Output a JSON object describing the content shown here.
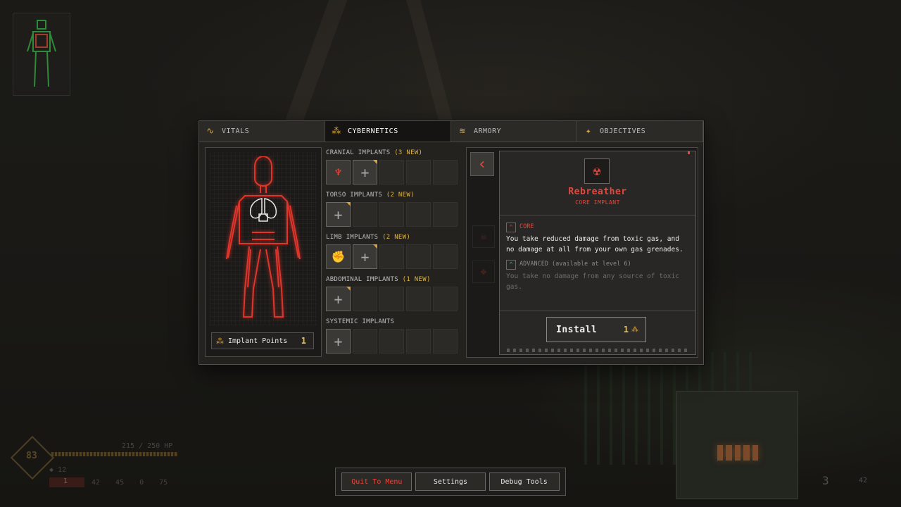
{
  "tabs": [
    {
      "label": "VITALS",
      "icon": "vitals-icon",
      "active": false
    },
    {
      "label": "CYBERNETICS",
      "icon": "cybernetics-icon",
      "active": true
    },
    {
      "label": "ARMORY",
      "icon": "armory-icon",
      "active": false
    },
    {
      "label": "OBJECTIVES",
      "icon": "objectives-icon",
      "active": false
    }
  ],
  "implant_points": {
    "label": "Implant Points",
    "value": "1"
  },
  "groups": [
    {
      "label": "CRANIAL IMPLANTS",
      "new": "(3 NEW)"
    },
    {
      "label": "TORSO IMPLANTS",
      "new": "(2 NEW)"
    },
    {
      "label": "LIMB IMPLANTS",
      "new": "(2 NEW)"
    },
    {
      "label": "ABDOMINAL IMPLANTS",
      "new": "(1 NEW)"
    },
    {
      "label": "SYSTEMIC IMPLANTS",
      "new": ""
    }
  ],
  "detail": {
    "name": "Rebreather",
    "subtitle": "CORE IMPLANT",
    "core_label": "CORE",
    "core_text": "You take reduced damage from toxic gas, and no damage at all from your own gas grenades.",
    "advanced_label": "ADVANCED (available at level 6)",
    "advanced_text": "You take no damage from any source of toxic gas.",
    "install_label": "Install",
    "install_cost": "1"
  },
  "hud": {
    "level": "83",
    "hp": "215 / 250 HP",
    "armor": "12",
    "grenades": "1",
    "stats": [
      "42",
      "45",
      "0",
      "75"
    ],
    "ammo_loaded": "3",
    "ammo_reserve": "42"
  },
  "menu": {
    "quit": "Quit To Menu",
    "settings": "Settings",
    "debug": "Debug Tools"
  },
  "colors": {
    "accent": "#d6a23a",
    "danger": "#e5483d",
    "advanced": "#4ad06a"
  }
}
